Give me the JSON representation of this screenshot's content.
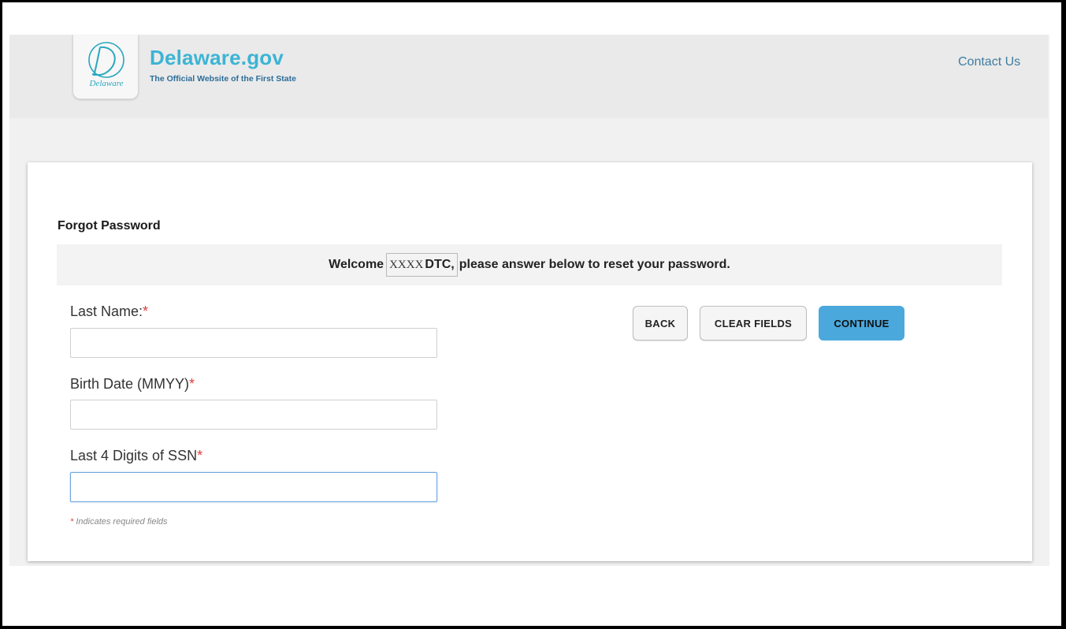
{
  "header": {
    "logo_letter": "D",
    "logo_script": "Delaware",
    "site_title": "Delaware.gov",
    "site_subtitle": "The Official Website of the First State",
    "contact_label": "Contact Us"
  },
  "form": {
    "title": "Forgot Password",
    "welcome_prefix": "Welcome",
    "username_masked": "XXXX",
    "username_suffix": "DTC,",
    "welcome_suffix": "please answer below to reset your password.",
    "required_marker": "*",
    "fields": [
      {
        "label": "Last Name:",
        "value": "",
        "focused": false
      },
      {
        "label": "Birth Date (MMYY)",
        "value": "",
        "focused": false
      },
      {
        "label": "Last 4 Digits of SSN",
        "value": "",
        "focused": true
      }
    ],
    "required_note": "Indicates required fields"
  },
  "buttons": {
    "back": "BACK",
    "clear": "CLEAR FIELDS",
    "continue": "CONTINUE"
  },
  "colors": {
    "accent": "#4aa8dc",
    "brand": "#3cb4d4",
    "required": "#e03b3b"
  }
}
